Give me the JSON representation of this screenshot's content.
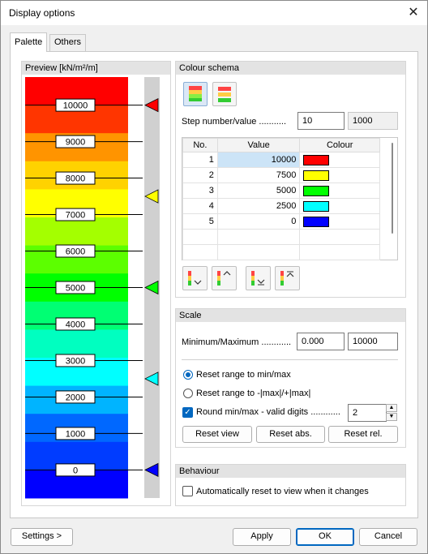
{
  "window": {
    "title": "Display options",
    "close_glyph": "✕"
  },
  "tabs": [
    {
      "label": "Palette"
    },
    {
      "label": "Others"
    }
  ],
  "preview": {
    "header": "Preview [kN/m²/m]",
    "bands": [
      "#ff0000",
      "#ff3500",
      "#ff9400",
      "#ffd200",
      "#ffff00",
      "#a4ff00",
      "#5cff00",
      "#00ff00",
      "#00ff73",
      "#00ffc0",
      "#00ffff",
      "#00b4ff",
      "#0068ff",
      "#003cff",
      "#0000ff"
    ],
    "labels": [
      "10000",
      "9000",
      "8000",
      "7000",
      "6000",
      "5000",
      "4000",
      "3000",
      "2000",
      "1000",
      "0"
    ],
    "markers": [
      {
        "value": 10000,
        "color": "#ff0000"
      },
      {
        "value": 7500,
        "color": "#ffff00"
      },
      {
        "value": 5000,
        "color": "#00ff00"
      },
      {
        "value": 2500,
        "color": "#00ffff"
      },
      {
        "value": 0,
        "color": "#0000ff"
      }
    ]
  },
  "colour_schema": {
    "header": "Colour schema",
    "step_label": "Step number/value ...........",
    "step_number": "10",
    "step_value": "1000",
    "columns": [
      "No.",
      "Value",
      "Colour"
    ],
    "rows": [
      {
        "no": "1",
        "value": "10000",
        "color": "#ff0000"
      },
      {
        "no": "2",
        "value": "7500",
        "color": "#ffff00"
      },
      {
        "no": "3",
        "value": "5000",
        "color": "#00ff00"
      },
      {
        "no": "4",
        "value": "2500",
        "color": "#00ffff"
      },
      {
        "no": "5",
        "value": "0",
        "color": "#0000ff"
      }
    ]
  },
  "scale": {
    "header": "Scale",
    "minmax_label": "Minimum/Maximum ............",
    "min": "0.000",
    "max": "10000",
    "radio1": "Reset range to min/max",
    "radio2": "Reset range to -|max|/+|max|",
    "round_label": "Round min/max - valid digits ............",
    "digits": "2",
    "btn_view": "Reset view",
    "btn_abs": "Reset abs.",
    "btn_rel": "Reset rel."
  },
  "behaviour": {
    "header": "Behaviour",
    "auto_label": "Automatically reset to view when it changes"
  },
  "footer": {
    "settings": "Settings >",
    "apply": "Apply",
    "ok": "OK",
    "cancel": "Cancel"
  }
}
